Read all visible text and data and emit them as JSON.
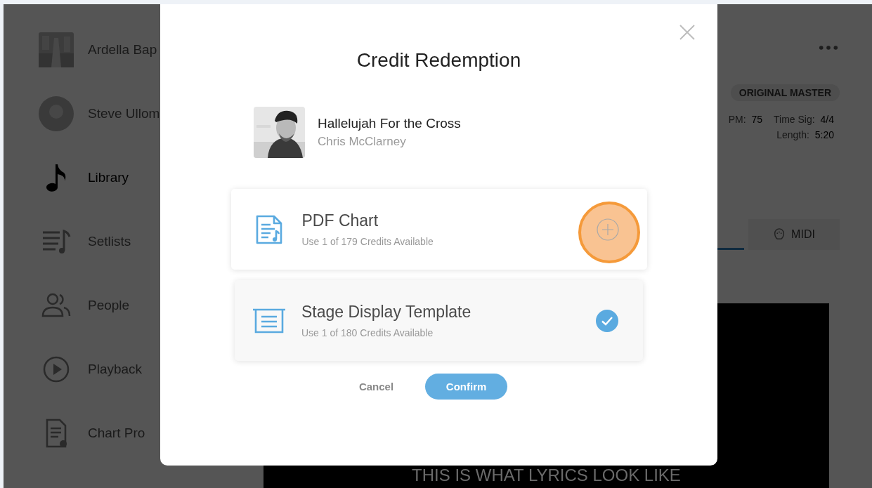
{
  "sidebar": {
    "items": [
      {
        "label": "Ardella Bap",
        "selected": false
      },
      {
        "kind": "avatar",
        "label": "Steve Ullom",
        "selected": false
      },
      {
        "kind": "library",
        "label": "Library",
        "selected": true
      },
      {
        "kind": "setlists",
        "label": "Setlists",
        "selected": false
      },
      {
        "kind": "people",
        "label": "People",
        "selected": false
      },
      {
        "kind": "playback",
        "label": "Playback",
        "selected": false
      },
      {
        "kind": "chartpro",
        "label": "Chart Pro",
        "selected": false
      }
    ]
  },
  "song_header": {
    "badge": "ORIGINAL MASTER",
    "meta": [
      {
        "label": "PM:",
        "value": "75"
      },
      {
        "label": "Time Sig:",
        "value": "4/4"
      },
      {
        "label": "Length:",
        "value": "5:20"
      }
    ]
  },
  "tabs": [
    {
      "selected": true
    },
    {
      "label": "MIDI",
      "selected": false
    }
  ],
  "lyrics": "THIS IS WHAT LYRICS LOOK LIKE",
  "dialog": {
    "title": "Credit Redemption",
    "song": {
      "title": "Hallelujah For the Cross",
      "artist": "Chris McClarney"
    },
    "options": [
      {
        "kind": "pdf",
        "title": "PDF Chart",
        "subtitle": "Use 1 of 179 Credits Available",
        "checked": false,
        "highlighted": true
      },
      {
        "kind": "stage",
        "title": "Stage Display Template",
        "subtitle": "Use 1 of 180 Credits Available",
        "checked": true,
        "highlighted": false
      }
    ],
    "buttons": [
      {
        "kind": "text",
        "label": "Cancel"
      },
      {
        "kind": "primary",
        "label": "Confirm"
      }
    ]
  }
}
